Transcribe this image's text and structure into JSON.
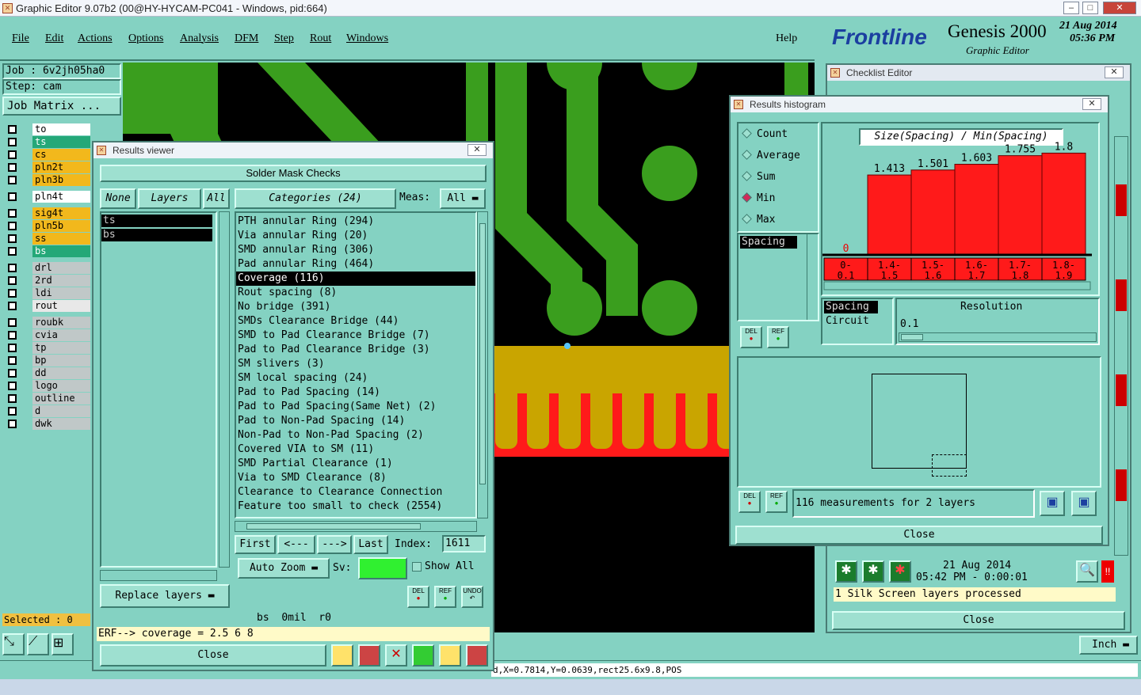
{
  "window": {
    "title": "Graphic Editor 9.07b2 (00@HY-HYCAM-PC041 - Windows, pid:664)"
  },
  "menu": {
    "items": [
      "File",
      "Edit",
      "Actions",
      "Options",
      "Analysis",
      "DFM",
      "Step",
      "Rout",
      "Windows"
    ],
    "help": "Help"
  },
  "brand": {
    "logo": "Frontline",
    "product": "Genesis 2000",
    "subtitle": "Graphic Editor",
    "date": "21 Aug 2014",
    "time": "05:36 PM"
  },
  "job": {
    "job_label": "Job : 6v2jh05ha0",
    "step_label": "Step: cam",
    "matrix_button": "Job Matrix ..."
  },
  "layers": [
    {
      "name": "to",
      "color": "#ffffff"
    },
    {
      "name": "ts",
      "color": "#24a878"
    },
    {
      "name": "cs",
      "color": "#f2b81c"
    },
    {
      "name": "pln2t",
      "color": "#f2b81c"
    },
    {
      "name": "pln3b",
      "color": "#f2b81c"
    },
    {
      "name": "pln4t",
      "color": "#ffffff"
    },
    {
      "name": "sig4t",
      "color": "#f2b81c"
    },
    {
      "name": "pln5b",
      "color": "#f2b81c"
    },
    {
      "name": "ss",
      "color": "#f2b81c"
    },
    {
      "name": "bs",
      "color": "#24a878"
    },
    {
      "name": "drl",
      "color": "#c0c8c8"
    },
    {
      "name": "2rd",
      "color": "#c0c8c8"
    },
    {
      "name": "ldi",
      "color": "#c0c8c8"
    },
    {
      "name": "rout",
      "color": "#e8e8e8"
    },
    {
      "name": "roubk",
      "color": "#c0c8c8"
    },
    {
      "name": "cvia",
      "color": "#c0c8c8"
    },
    {
      "name": "tp",
      "color": "#c0c8c8"
    },
    {
      "name": "bp",
      "color": "#c0c8c8"
    },
    {
      "name": "dd",
      "color": "#c0c8c8"
    },
    {
      "name": "logo",
      "color": "#c0c8c8"
    },
    {
      "name": "outline",
      "color": "#c0c8c8"
    },
    {
      "name": "d",
      "color": "#c0c8c8"
    },
    {
      "name": "dwk",
      "color": "#c0c8c8"
    }
  ],
  "selected_label": "Selected : 0",
  "status_bar": {
    "text": "d,X=0.7814,Y=0.0639,rect25.6x9.8,POS",
    "unit": "Inch"
  },
  "results_viewer": {
    "title": "Results viewer",
    "heading": "Solder Mask Checks",
    "none_btn": "None",
    "layers_btn": "Layers",
    "all_btn": "All",
    "categories_btn": "Categories (24)",
    "meas_label": "Meas:",
    "meas_value": "All",
    "layers": [
      "ts",
      "bs"
    ],
    "categories": [
      "PTH annular Ring (294)",
      "Via annular Ring (20)",
      "SMD annular Ring (306)",
      "Pad annular Ring (464)",
      "Coverage (116)",
      "Rout spacing (8)",
      "No bridge (391)",
      "SMDs Clearance Bridge (44)",
      "SMD to Pad Clearance Bridge (7)",
      "Pad to Pad Clearance Bridge (3)",
      "SM slivers (3)",
      "SM local spacing (24)",
      "Pad to Pad Spacing (14)",
      "Pad to Pad Spacing(Same Net) (2)",
      "Pad to Non-Pad Spacing (14)",
      "Non-Pad to Non-Pad Spacing (2)",
      "Covered VIA to SM (11)",
      "SMD Partial Clearance (1)",
      "Via to SMD Clearance (8)",
      "Clearance to Clearance Connection",
      "Feature too small to check (2554)"
    ],
    "selected_index": 4,
    "first_btn": "First",
    "prev_btn": "<---",
    "next_btn": "--->",
    "last_btn": "Last",
    "index_label": "Index:",
    "index_value": "1611",
    "zoom_value": "Auto Zoom",
    "sv_label": "Sv:",
    "show_all": "Show All",
    "replace_layers": "Replace layers",
    "del": "DEL",
    "ref": "REF",
    "undo": "UNDO",
    "status": "bs  0mil  r0",
    "erf": "ERF--> coverage = 2.5 6 8",
    "close": "Close"
  },
  "checklist": {
    "title": "Checklist Editor",
    "date": "21 Aug 2014",
    "time": "05:42 PM - 0:00:01",
    "message": "1 Silk Screen layers processed",
    "close": "Close"
  },
  "histogram": {
    "title": "Results histogram",
    "modes": [
      "Count",
      "Average",
      "Sum",
      "Min",
      "Max"
    ],
    "selected_mode": "Min",
    "chart_title": "Size(Spacing) / Min(Spacing)",
    "left_list": [
      "Spacing"
    ],
    "measure_list": [
      "Spacing",
      "Circuit"
    ],
    "resolution_label": "Resolution",
    "resolution_value": "0.1",
    "del": "DEL",
    "ref": "REF",
    "summary": "116 measurements for 2 layers",
    "close": "Close"
  },
  "chart_data": {
    "type": "bar",
    "categories": [
      "0-0.1",
      "1.4-1.5",
      "1.5-1.6",
      "1.6-1.7",
      "1.7-1.8",
      "1.8-1.9"
    ],
    "values": [
      0,
      1.413,
      1.501,
      1.603,
      1.755,
      1.8
    ],
    "value_labels": [
      "0",
      "1.413",
      "1.501",
      "1.603",
      "1.755",
      "1.8"
    ],
    "title": "Size(Spacing) / Min(Spacing)",
    "ylim": [
      0,
      2.1
    ],
    "bar_color": "#ff1a1a"
  }
}
